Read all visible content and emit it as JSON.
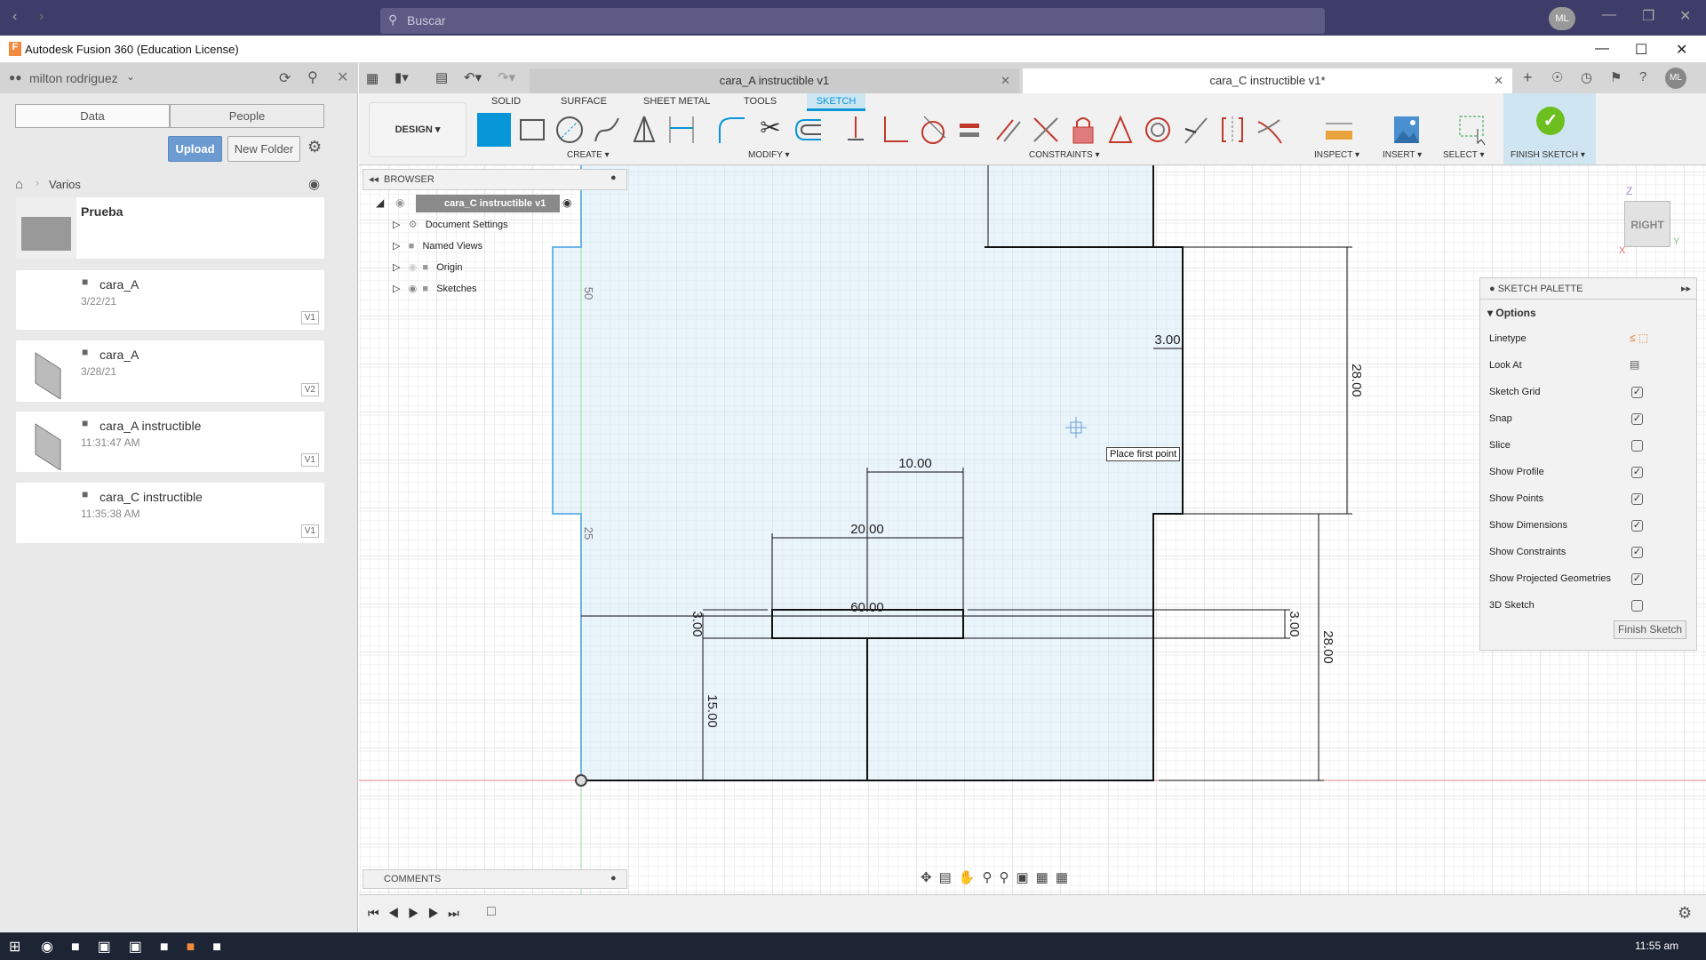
{
  "os": {
    "search_placeholder": "Buscar",
    "avatar": "ML",
    "clock": "11:55 am"
  },
  "app": {
    "title": "Autodesk Fusion 360 (Education License)"
  },
  "data_panel": {
    "user": "milton rodriguez",
    "tabs": [
      "Data",
      "People"
    ],
    "upload": "Upload",
    "new_folder": "New Folder",
    "breadcrumb": "Varios",
    "items": [
      {
        "name": "Prueba",
        "date": "",
        "version": "",
        "type": "folder"
      },
      {
        "name": "cara_A",
        "date": "3/22/21",
        "version": "V1",
        "type": "design"
      },
      {
        "name": "cara_A",
        "date": "3/28/21",
        "version": "V2",
        "type": "design"
      },
      {
        "name": "cara_A instructible",
        "date": "11:31:47 AM",
        "version": "V1",
        "type": "design"
      },
      {
        "name": "cara_C instructible",
        "date": "11:35:38 AM",
        "version": "V1",
        "type": "design"
      }
    ]
  },
  "doc_tabs": [
    {
      "label": "cara_A instructible v1",
      "active": false
    },
    {
      "label": "cara_C instructible v1*",
      "active": true
    }
  ],
  "toolbar": {
    "workspace": "DESIGN",
    "tabs": [
      "SOLID",
      "SURFACE",
      "SHEET METAL",
      "TOOLS",
      "SKETCH"
    ],
    "active_tab": "SKETCH",
    "groups": [
      "CREATE",
      "MODIFY",
      "CONSTRAINTS",
      "INSPECT",
      "INSERT",
      "SELECT",
      "FINISH SKETCH"
    ]
  },
  "browser": {
    "title": "BROWSER",
    "root": "cara_C instructible v1",
    "items": [
      "Document Settings",
      "Named Views",
      "Origin",
      "Sketches"
    ]
  },
  "sketch": {
    "dimensions": [
      "10.00",
      "20.00",
      "60.00",
      "3.00",
      "15.00",
      "3.00",
      "3.00",
      "28.00",
      "28.00"
    ],
    "grid_labels": [
      "50",
      "25"
    ],
    "tooltip": "Place first point"
  },
  "viewcube": {
    "face": "RIGHT",
    "axis_z": "Z",
    "axis_y": "Y",
    "axis_x": "X"
  },
  "palette": {
    "title": "SKETCH PALETTE",
    "section": "Options",
    "rows": [
      {
        "label": "Linetype",
        "type": "icons"
      },
      {
        "label": "Look At",
        "type": "icon"
      },
      {
        "label": "Sketch Grid",
        "checked": true
      },
      {
        "label": "Snap",
        "checked": true
      },
      {
        "label": "Slice",
        "checked": false
      },
      {
        "label": "Show Profile",
        "checked": true
      },
      {
        "label": "Show Points",
        "checked": true
      },
      {
        "label": "Show Dimensions",
        "checked": true
      },
      {
        "label": "Show Constraints",
        "checked": true
      },
      {
        "label": "Show Projected Geometries",
        "checked": true
      },
      {
        "label": "3D Sketch",
        "checked": false
      }
    ],
    "finish": "Finish Sketch"
  },
  "comments": {
    "title": "COMMENTS"
  },
  "colors": {
    "accent": "#0696d7",
    "finish": "#6cbf1f",
    "constraint": "#c0392b",
    "titlebar": "#3e3c68"
  }
}
